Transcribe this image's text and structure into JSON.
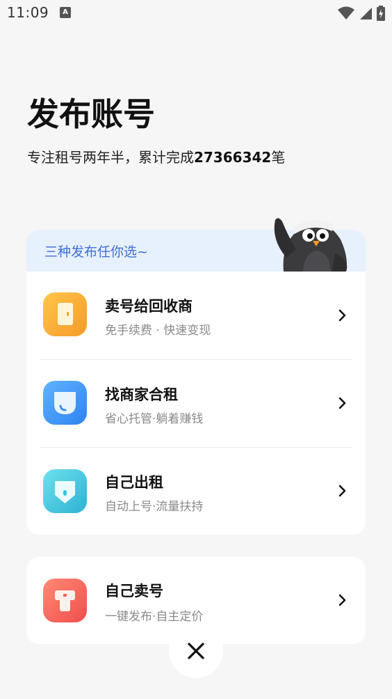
{
  "status_bar": {
    "time": "11:09",
    "notification_letter": "A"
  },
  "header": {
    "title": "发布账号",
    "subtitle_prefix": "专注租号两年半，累计完成",
    "count": "27366342",
    "subtitle_suffix": "笔"
  },
  "options_card": {
    "banner": "三种发布任你选~",
    "items": [
      {
        "title": "卖号给回收商",
        "subtitle": "免手续费 · 快速变现",
        "icon": "recycle-orange-icon",
        "color": "#f7a234"
      },
      {
        "title": "找商家合租",
        "subtitle": "省心托管·躺着赚钱",
        "icon": "merchant-blue-icon",
        "color": "#3d8ff5"
      },
      {
        "title": "自己出租",
        "subtitle": "自动上号·流量扶持",
        "icon": "rent-cyan-icon",
        "color": "#3cc3de"
      }
    ]
  },
  "sell_card": {
    "title": "自己卖号",
    "subtitle": "一键发布·自主定价",
    "icon": "sell-red-icon",
    "color": "#f4605a"
  },
  "close": {
    "icon": "close-icon"
  },
  "colors": {
    "accent_blue": "#3f6fd8",
    "banner_bg": "#e7f0fd"
  }
}
